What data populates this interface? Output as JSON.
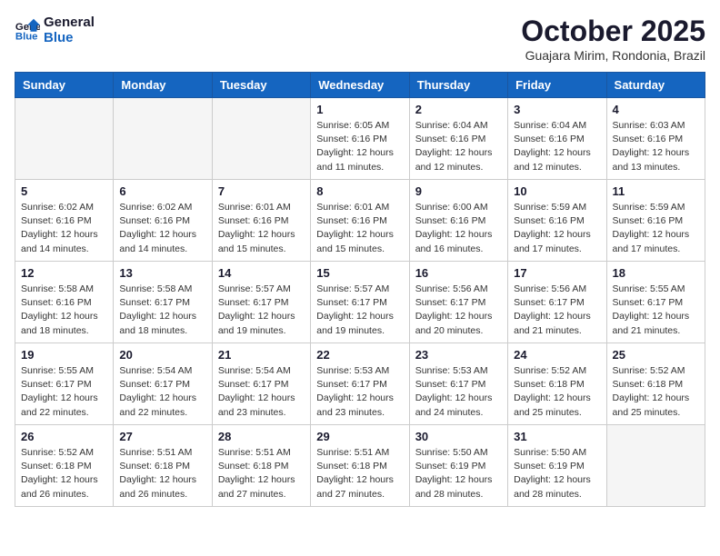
{
  "header": {
    "logo_line1": "General",
    "logo_line2": "Blue",
    "month": "October 2025",
    "location": "Guajara Mirim, Rondonia, Brazil"
  },
  "weekdays": [
    "Sunday",
    "Monday",
    "Tuesday",
    "Wednesday",
    "Thursday",
    "Friday",
    "Saturday"
  ],
  "weeks": [
    [
      {
        "day": "",
        "info": ""
      },
      {
        "day": "",
        "info": ""
      },
      {
        "day": "",
        "info": ""
      },
      {
        "day": "1",
        "info": "Sunrise: 6:05 AM\nSunset: 6:16 PM\nDaylight: 12 hours\nand 11 minutes."
      },
      {
        "day": "2",
        "info": "Sunrise: 6:04 AM\nSunset: 6:16 PM\nDaylight: 12 hours\nand 12 minutes."
      },
      {
        "day": "3",
        "info": "Sunrise: 6:04 AM\nSunset: 6:16 PM\nDaylight: 12 hours\nand 12 minutes."
      },
      {
        "day": "4",
        "info": "Sunrise: 6:03 AM\nSunset: 6:16 PM\nDaylight: 12 hours\nand 13 minutes."
      }
    ],
    [
      {
        "day": "5",
        "info": "Sunrise: 6:02 AM\nSunset: 6:16 PM\nDaylight: 12 hours\nand 14 minutes."
      },
      {
        "day": "6",
        "info": "Sunrise: 6:02 AM\nSunset: 6:16 PM\nDaylight: 12 hours\nand 14 minutes."
      },
      {
        "day": "7",
        "info": "Sunrise: 6:01 AM\nSunset: 6:16 PM\nDaylight: 12 hours\nand 15 minutes."
      },
      {
        "day": "8",
        "info": "Sunrise: 6:01 AM\nSunset: 6:16 PM\nDaylight: 12 hours\nand 15 minutes."
      },
      {
        "day": "9",
        "info": "Sunrise: 6:00 AM\nSunset: 6:16 PM\nDaylight: 12 hours\nand 16 minutes."
      },
      {
        "day": "10",
        "info": "Sunrise: 5:59 AM\nSunset: 6:16 PM\nDaylight: 12 hours\nand 17 minutes."
      },
      {
        "day": "11",
        "info": "Sunrise: 5:59 AM\nSunset: 6:16 PM\nDaylight: 12 hours\nand 17 minutes."
      }
    ],
    [
      {
        "day": "12",
        "info": "Sunrise: 5:58 AM\nSunset: 6:16 PM\nDaylight: 12 hours\nand 18 minutes."
      },
      {
        "day": "13",
        "info": "Sunrise: 5:58 AM\nSunset: 6:17 PM\nDaylight: 12 hours\nand 18 minutes."
      },
      {
        "day": "14",
        "info": "Sunrise: 5:57 AM\nSunset: 6:17 PM\nDaylight: 12 hours\nand 19 minutes."
      },
      {
        "day": "15",
        "info": "Sunrise: 5:57 AM\nSunset: 6:17 PM\nDaylight: 12 hours\nand 19 minutes."
      },
      {
        "day": "16",
        "info": "Sunrise: 5:56 AM\nSunset: 6:17 PM\nDaylight: 12 hours\nand 20 minutes."
      },
      {
        "day": "17",
        "info": "Sunrise: 5:56 AM\nSunset: 6:17 PM\nDaylight: 12 hours\nand 21 minutes."
      },
      {
        "day": "18",
        "info": "Sunrise: 5:55 AM\nSunset: 6:17 PM\nDaylight: 12 hours\nand 21 minutes."
      }
    ],
    [
      {
        "day": "19",
        "info": "Sunrise: 5:55 AM\nSunset: 6:17 PM\nDaylight: 12 hours\nand 22 minutes."
      },
      {
        "day": "20",
        "info": "Sunrise: 5:54 AM\nSunset: 6:17 PM\nDaylight: 12 hours\nand 22 minutes."
      },
      {
        "day": "21",
        "info": "Sunrise: 5:54 AM\nSunset: 6:17 PM\nDaylight: 12 hours\nand 23 minutes."
      },
      {
        "day": "22",
        "info": "Sunrise: 5:53 AM\nSunset: 6:17 PM\nDaylight: 12 hours\nand 23 minutes."
      },
      {
        "day": "23",
        "info": "Sunrise: 5:53 AM\nSunset: 6:17 PM\nDaylight: 12 hours\nand 24 minutes."
      },
      {
        "day": "24",
        "info": "Sunrise: 5:52 AM\nSunset: 6:18 PM\nDaylight: 12 hours\nand 25 minutes."
      },
      {
        "day": "25",
        "info": "Sunrise: 5:52 AM\nSunset: 6:18 PM\nDaylight: 12 hours\nand 25 minutes."
      }
    ],
    [
      {
        "day": "26",
        "info": "Sunrise: 5:52 AM\nSunset: 6:18 PM\nDaylight: 12 hours\nand 26 minutes."
      },
      {
        "day": "27",
        "info": "Sunrise: 5:51 AM\nSunset: 6:18 PM\nDaylight: 12 hours\nand 26 minutes."
      },
      {
        "day": "28",
        "info": "Sunrise: 5:51 AM\nSunset: 6:18 PM\nDaylight: 12 hours\nand 27 minutes."
      },
      {
        "day": "29",
        "info": "Sunrise: 5:51 AM\nSunset: 6:18 PM\nDaylight: 12 hours\nand 27 minutes."
      },
      {
        "day": "30",
        "info": "Sunrise: 5:50 AM\nSunset: 6:19 PM\nDaylight: 12 hours\nand 28 minutes."
      },
      {
        "day": "31",
        "info": "Sunrise: 5:50 AM\nSunset: 6:19 PM\nDaylight: 12 hours\nand 28 minutes."
      },
      {
        "day": "",
        "info": ""
      }
    ]
  ]
}
